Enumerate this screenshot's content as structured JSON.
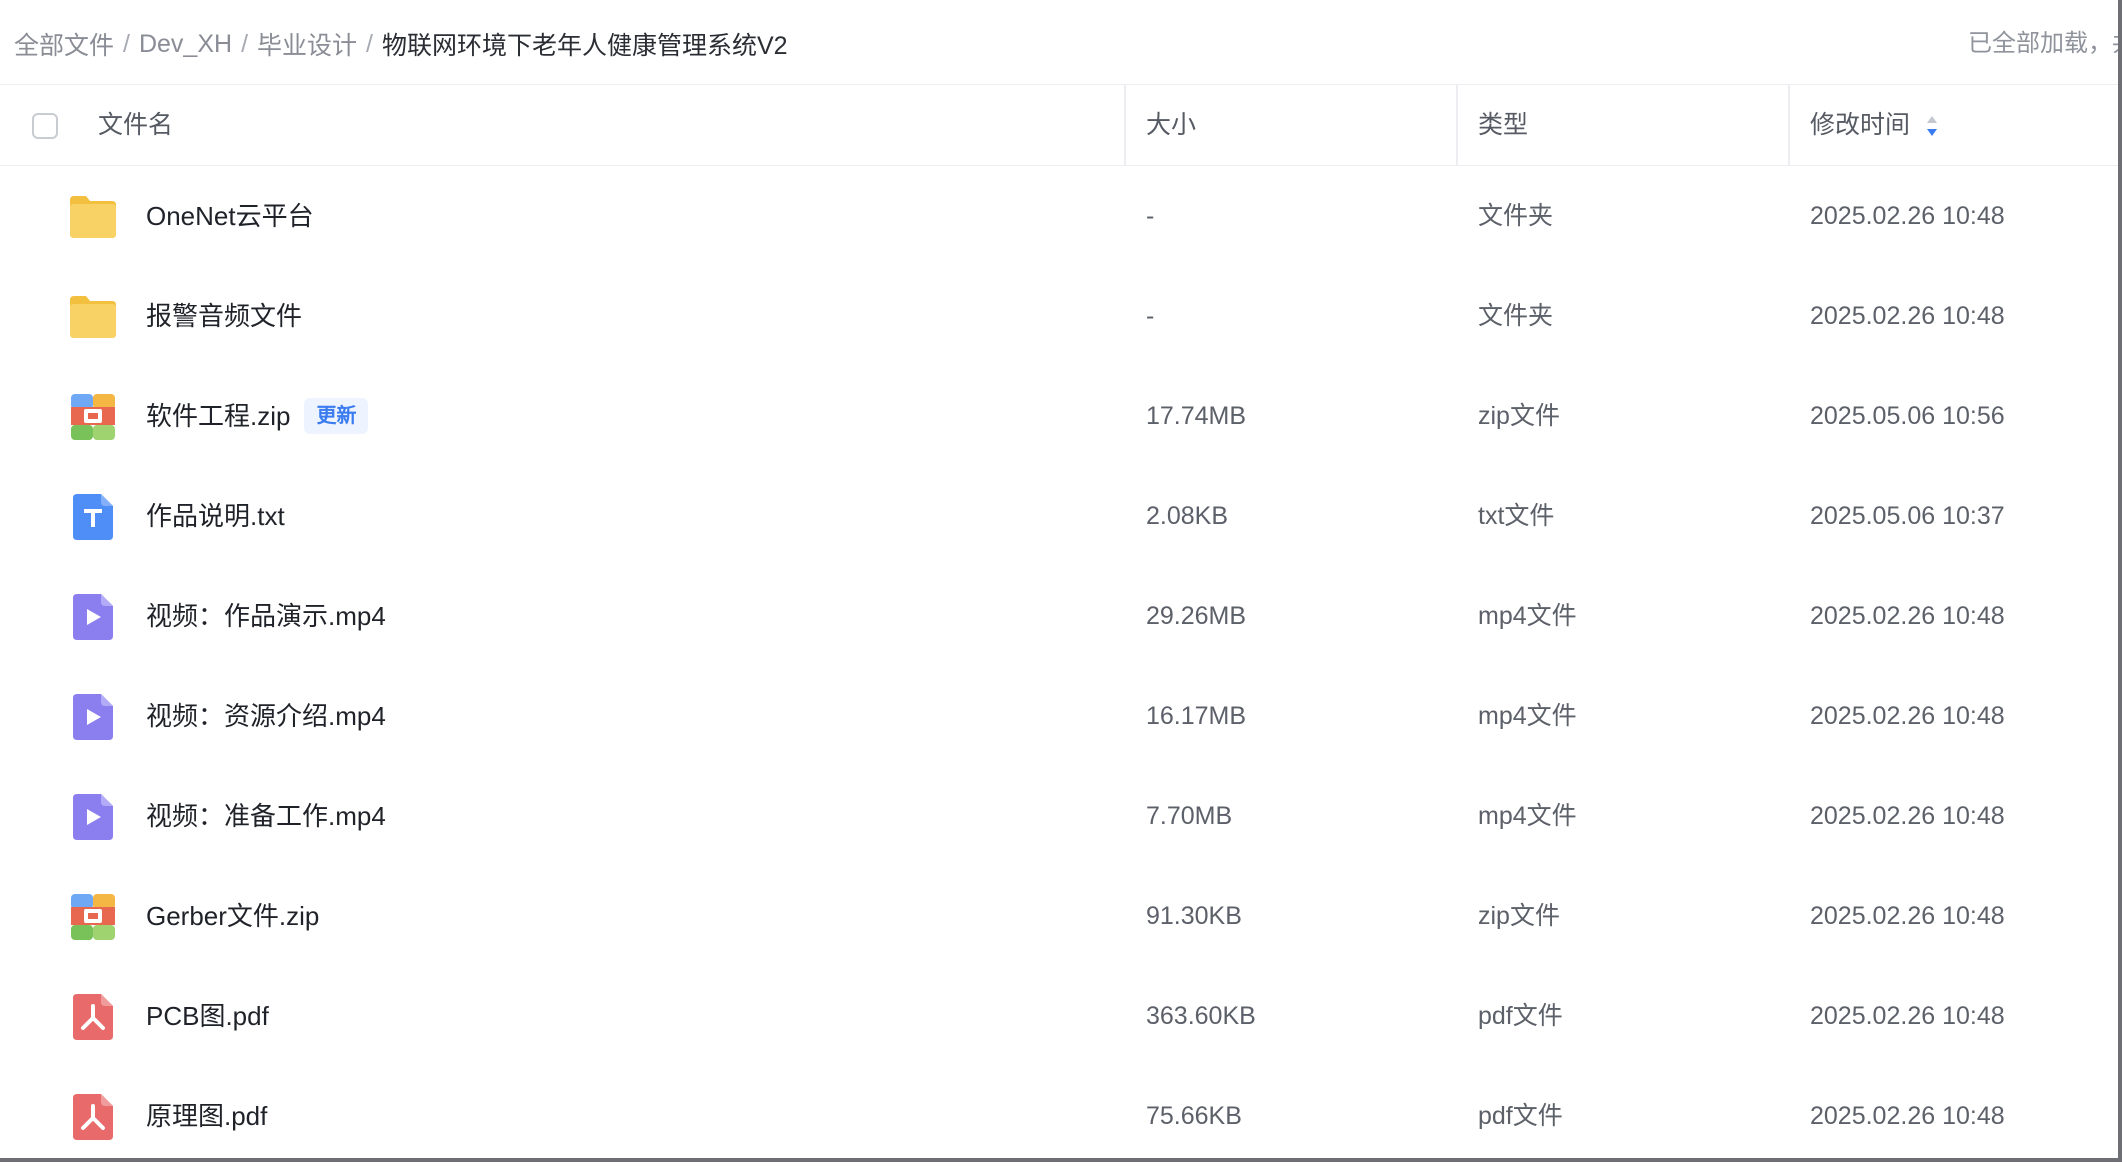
{
  "breadcrumb": {
    "items": [
      "全部文件",
      "Dev_XH",
      "毕业设计"
    ],
    "separator": "/",
    "current": "物联网环境下老年人健康管理系统V2"
  },
  "status": {
    "text": "已全部加载，共"
  },
  "table": {
    "headers": {
      "name": "文件名",
      "size": "大小",
      "type": "类型",
      "modified": "修改时间"
    },
    "sort_icon": "sort-desc-icon",
    "rows": [
      {
        "name": "OneNet云平台",
        "size": "-",
        "type": "文件夹",
        "date": "2025.02.26 10:48",
        "icon": "folder-icon",
        "tag": ""
      },
      {
        "name": "报警音频文件",
        "size": "-",
        "type": "文件夹",
        "date": "2025.02.26 10:48",
        "icon": "folder-icon",
        "tag": ""
      },
      {
        "name": "软件工程.zip",
        "size": "17.74MB",
        "type": "zip文件",
        "date": "2025.05.06 10:56",
        "icon": "zip-icon",
        "tag": "更新"
      },
      {
        "name": "作品说明.txt",
        "size": "2.08KB",
        "type": "txt文件",
        "date": "2025.05.06 10:37",
        "icon": "txt-icon",
        "tag": ""
      },
      {
        "name": "视频：作品演示.mp4",
        "size": "29.26MB",
        "type": "mp4文件",
        "date": "2025.02.26 10:48",
        "icon": "video-icon",
        "tag": ""
      },
      {
        "name": "视频：资源介绍.mp4",
        "size": "16.17MB",
        "type": "mp4文件",
        "date": "2025.02.26 10:48",
        "icon": "video-icon",
        "tag": ""
      },
      {
        "name": "视频：准备工作.mp4",
        "size": "7.70MB",
        "type": "mp4文件",
        "date": "2025.02.26 10:48",
        "icon": "video-icon",
        "tag": ""
      },
      {
        "name": "Gerber文件.zip",
        "size": "91.30KB",
        "type": "zip文件",
        "date": "2025.02.26 10:48",
        "icon": "zip-icon",
        "tag": ""
      },
      {
        "name": "PCB图.pdf",
        "size": "363.60KB",
        "type": "pdf文件",
        "date": "2025.02.26 10:48",
        "icon": "pdf-icon",
        "tag": ""
      },
      {
        "name": "原理图.pdf",
        "size": "75.66KB",
        "type": "pdf文件",
        "date": "2025.02.26 10:48",
        "icon": "pdf-icon",
        "tag": ""
      }
    ]
  },
  "colors": {
    "folder": "#f7c94e",
    "txt": "#4f8ef7",
    "video": "#8b7ff0",
    "pdf": "#e86a6a",
    "tag_text": "#3a7bf0",
    "sort_active": "#3a7bf0"
  }
}
